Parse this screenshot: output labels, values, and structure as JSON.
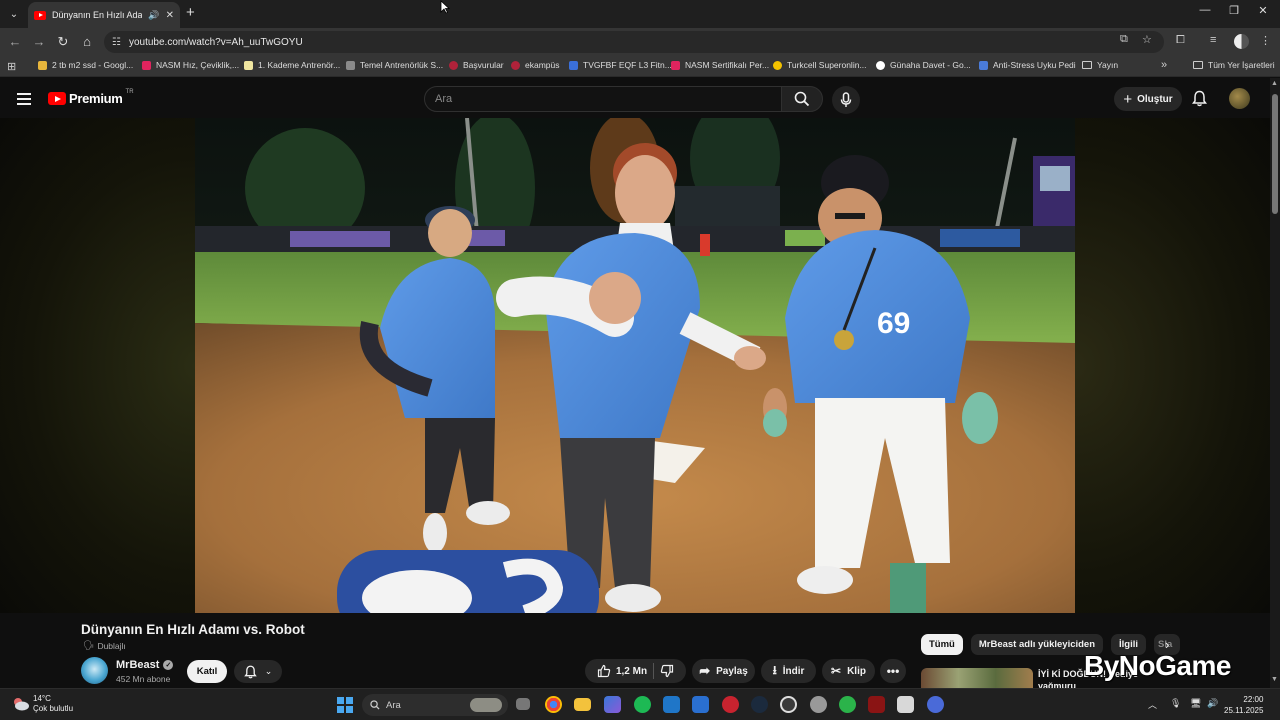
{
  "browser": {
    "tab_title": "Dünyanın En Hızlı Adamı vs",
    "url": "youtube.com/watch?v=Ah_uuTwGOYU",
    "bookmarks": [
      {
        "label": "2 tb m2 ssd - Googl...",
        "color": "#e8b63c"
      },
      {
        "label": "NASM Hız, Çeviklik,...",
        "color": "#e0245e"
      },
      {
        "label": "1. Kademe Antrenör...",
        "color": "#f0e6a0"
      },
      {
        "label": "Temel Antrenörlük S...",
        "color": "#8a8a8a"
      },
      {
        "label": "Başvurular",
        "color": "#b0223a"
      },
      {
        "label": "ekampüs",
        "color": "#b0223a"
      },
      {
        "label": "TVGFBF EQF L3 Fitn...",
        "color": "#3a6fd8"
      },
      {
        "label": "NASM Sertifikalı Per...",
        "color": "#e0245e"
      },
      {
        "label": "Turkcell Superonlin...",
        "color": "#f3c200"
      },
      {
        "label": "Günaha Davet - Go...",
        "color": "#ffffff"
      },
      {
        "label": "Anti-Stress Uyku Pedi",
        "color": "#4a7bd8"
      },
      {
        "label": "Yayın",
        "color": "#cccccc"
      }
    ],
    "all_bookmarks": "Tüm Yer İşaretleri"
  },
  "youtube": {
    "logo_text": "Premium",
    "country_code": "TR",
    "search_placeholder": "Ara",
    "create_label": "Oluştur"
  },
  "video": {
    "title": "Dünyanın En Hızlı Adamı vs. Robot",
    "dubbed_label": "Dublajlı",
    "channel": "MrBeast",
    "subscribers": "452 Mn abone",
    "join_label": "Katıl",
    "likes": "1,2 Mn",
    "share_label": "Paylaş",
    "download_label": "İndir",
    "clip_label": "Klip",
    "jersey_number": "69"
  },
  "recommendations": {
    "chips": [
      "Tümü",
      "MrBeast adlı yükleyiciden",
      "İlgili",
      "Sla"
    ],
    "first_title": "İYİ Kİ DOĞDUN! Hediye yağmuru"
  },
  "watermark": "ByNoGame",
  "taskbar": {
    "temperature": "14°C",
    "weather": "Çok bulutlu",
    "search_placeholder": "Ara",
    "time": "22:00",
    "date": "25.11.2025"
  }
}
